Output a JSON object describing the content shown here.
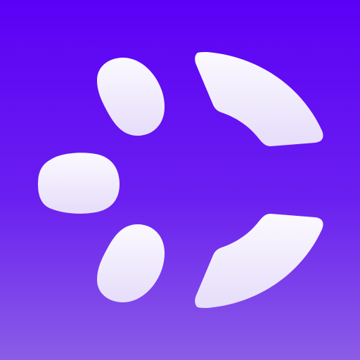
{
  "icon": {
    "name": "app-logo-icon",
    "background_top": "#5b00f6",
    "background_bottom": "#8a5de6",
    "glyph_top": "#fbf9ff",
    "glyph_bottom": "#e6ddfa"
  }
}
